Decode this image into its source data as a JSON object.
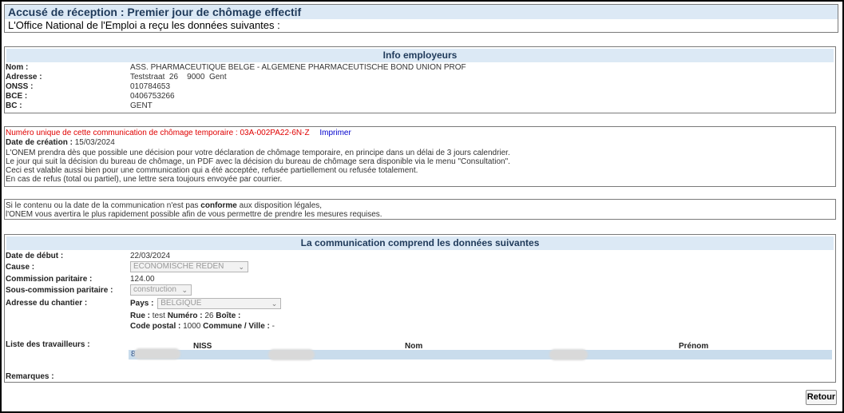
{
  "header": {
    "title": "Accusé de réception : Premier jour de chômage effectif",
    "subtitle": "L'Office National de l'Emploi a reçu les données suivantes :"
  },
  "employer": {
    "section_title": "Info employeurs",
    "labels": {
      "nom": "Nom :",
      "adresse": "Adresse :",
      "onss": "ONSS :",
      "bce": "BCE :",
      "bc": "BC :"
    },
    "values": {
      "nom": "ASS. PHARMACEUTIQUE BELGE - ALGEMENE PHARMACEUTISCHE BOND UNION PROF",
      "adresse": "Teststraat  26    9000  Gent",
      "onss": "010784653",
      "bce": "0406753266",
      "bc": "GENT"
    }
  },
  "communication": {
    "unique_number_text": "Numéro unique de cette communication de chômage temporaire : 03A-002PA22-6N-Z",
    "print_link": "Imprimer",
    "creation_label": "Date de création :",
    "creation_value": "15/03/2024",
    "lines": [
      "L'ONEM prendra dès que possible une décision pour votre déclaration de chômage temporaire, en principe dans un délai de 3 jours calendrier.",
      "Le jour qui suit la décision du bureau de chômage, un PDF avec la décision du bureau de chômage sera disponible via le menu \"Consultation\".",
      "Ceci est valable aussi bien pour une communication qui a été acceptée, refusée partiellement ou refusée totalement.",
      "En cas de refus (total ou partiel), une lettre sera toujours envoyée par courrier."
    ]
  },
  "notice": {
    "line1_pre": "Si le contenu ou la date de la communication n'est pas ",
    "line1_bold": "conforme",
    "line1_post": " aux disposition légales,",
    "line2": "l'ONEM vous avertira le plus rapidement possible afin de vous permettre de prendre les mesures requises."
  },
  "details": {
    "section_title": "La communication comprend les données suivantes",
    "labels": {
      "date_debut": "Date de début :",
      "cause": "Cause :",
      "commission": "Commission paritaire :",
      "sous_commission": "Sous-commission paritaire :",
      "adresse_chantier": "Adresse du chantier :",
      "liste": "Liste des travailleurs :",
      "remarques": "Remarques :"
    },
    "date_debut": "22/03/2024",
    "cause": "ECONOMISCHE REDEN",
    "commission": "124.00",
    "sous_commission": "construction",
    "chantier": {
      "pays_label": "Pays :",
      "pays_value": "BELGIQUE",
      "rue_label": "Rue :",
      "rue_value": "test",
      "numero_label": "Numéro :",
      "numero_value": "26",
      "boite_label": "Boîte :",
      "code_postal_label": "Code postal :",
      "code_postal_value": "1000",
      "commune_label": "Commune / Ville :",
      "commune_value": "-"
    },
    "workers": {
      "columns": [
        "NISS",
        "Nom",
        "Prénom"
      ],
      "row_first_char": "8"
    }
  },
  "actions": {
    "retour": "Retour"
  }
}
